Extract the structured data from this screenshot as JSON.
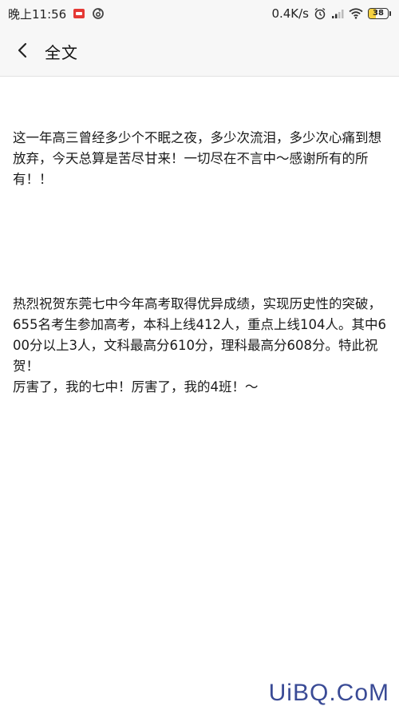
{
  "status_bar": {
    "time": "晚上11:56",
    "network_speed": "0.4K/s",
    "battery_level": "38",
    "battery_fraction": 0.38,
    "icons": [
      "app-notification-icon",
      "netease-music-icon",
      "alarm-icon",
      "signal-icon",
      "wifi-icon",
      "battery-icon"
    ]
  },
  "header": {
    "back_icon": "chevron-left-icon",
    "title": "全文"
  },
  "article": {
    "paragraphs": [
      "这一年高三曾经多少个不眠之夜，多少次流泪，多少次心痛到想放弃，今天总算是苦尽甘来！一切尽在不言中～感谢所有的所有！！",
      "热烈祝贺东莞七中今年高考取得优异成绩，实现历史性的突破，655名考生参加高考，本科上线412人，重点上线104人。其中600分以上3人，文科最高分610分，理科最高分608分。特此祝贺！\n厉害了，我的七中！厉害了，我的4班！～"
    ]
  },
  "watermark": {
    "text": "UiBQ.CoM"
  },
  "colors": {
    "background": "#ffffff",
    "bar_background": "#f7f7f7",
    "text": "#1a1a1a",
    "battery_fill": "#f4d03f",
    "watermark": "#3a4b96"
  }
}
